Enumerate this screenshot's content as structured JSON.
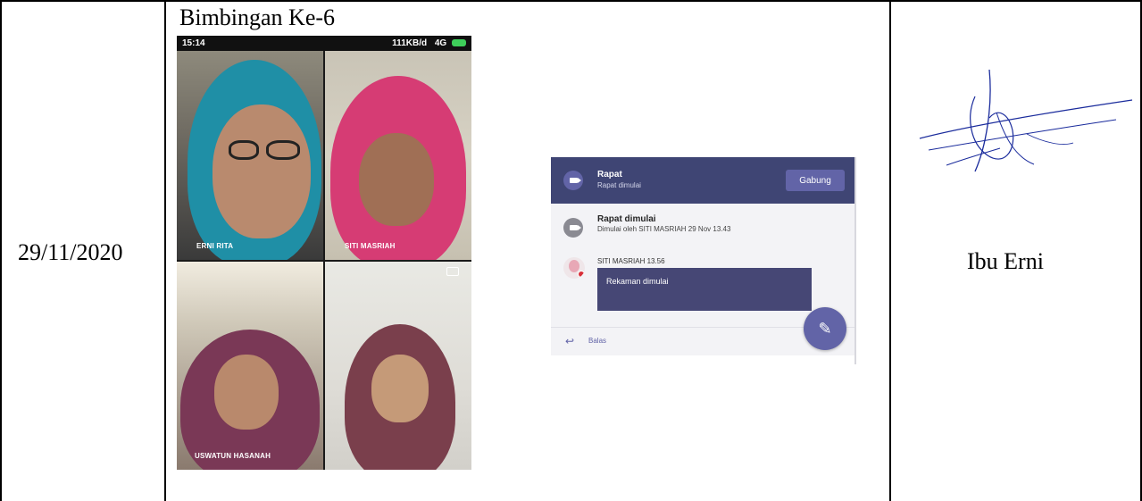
{
  "table": {
    "date": "29/11/2020",
    "session_title": "Bimbingan Ke-6",
    "signer": "Ibu Erni"
  },
  "phone": {
    "status_time": "15:14",
    "status_right": "111KB/d",
    "network": "4G",
    "participants": [
      "ERNI RITA",
      "SITI MASRIAH",
      "USWATUN HASANAH"
    ]
  },
  "teams": {
    "header_title": "Rapat",
    "header_subtitle": "Rapat dimulai",
    "join_button": "Gabung",
    "event_title": "Rapat dimulai",
    "event_meta": "Dimulai oleh SITI MASRIAH   29 Nov 13.43",
    "message_author": "SITI MASRIAH   13.56",
    "message_text": "Rekaman dimulai",
    "reply_label": "Balas",
    "colors": {
      "header": "#3f4574",
      "accent": "#6264a7"
    }
  }
}
